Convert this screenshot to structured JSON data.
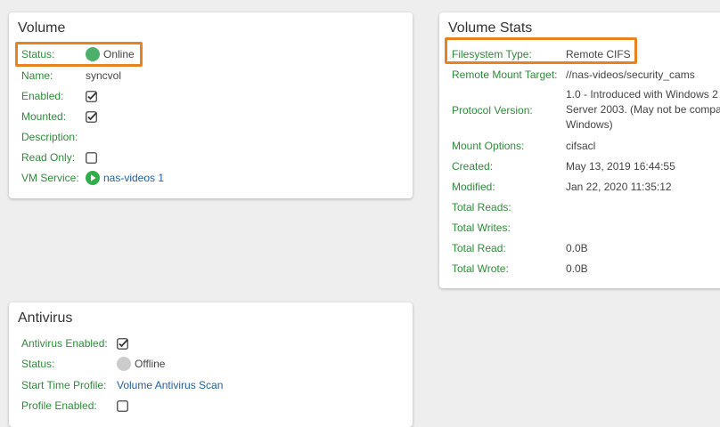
{
  "volume": {
    "title": "Volume",
    "status_label": "Status:",
    "status_value": "Online",
    "name_label": "Name:",
    "name_value": "syncvol",
    "enabled_label": "Enabled:",
    "enabled_checked": true,
    "mounted_label": "Mounted:",
    "mounted_checked": true,
    "description_label": "Description:",
    "description_value": "",
    "readonly_label": "Read Only:",
    "readonly_checked": false,
    "vmservice_label": "VM Service:",
    "vmservice_value": "nas-videos 1"
  },
  "stats": {
    "title": "Volume Stats",
    "fs_type_label": "Filesystem Type:",
    "fs_type_value": "Remote CIFS",
    "remote_target_label": "Remote Mount Target:",
    "remote_target_value": "//nas-videos/security_cams",
    "protocol_label": "Protocol Version:",
    "protocol_value_line1": "1.0 - Introduced with Windows 2",
    "protocol_value_line2": "Server 2003. (May not be compa",
    "protocol_value_line3": "Windows)",
    "mount_options_label": "Mount Options:",
    "mount_options_value": "cifsacl",
    "created_label": "Created:",
    "created_value": "May 13, 2019 16:44:55",
    "modified_label": "Modified:",
    "modified_value": "Jan 22, 2020 11:35:12",
    "total_reads_label": "Total Reads:",
    "total_reads_value": "",
    "total_writes_label": "Total Writes:",
    "total_writes_value": "",
    "total_read_label": "Total Read:",
    "total_read_value": "0.0B",
    "total_wrote_label": "Total Wrote:",
    "total_wrote_value": "0.0B"
  },
  "antivirus": {
    "title": "Antivirus",
    "enabled_label": "Antivirus Enabled:",
    "enabled_checked": true,
    "status_label": "Status:",
    "status_value": "Offline",
    "start_time_label": "Start Time Profile:",
    "start_time_value": "Volume Antivirus Scan",
    "profile_enabled_label": "Profile Enabled:",
    "profile_enabled_checked": false
  },
  "colors": {
    "label_green": "#2e8b3a",
    "highlight_orange": "#e8821e",
    "online_green": "#4caf6a",
    "offline_gray": "#cccccc",
    "link_blue": "#1f5fa6"
  }
}
